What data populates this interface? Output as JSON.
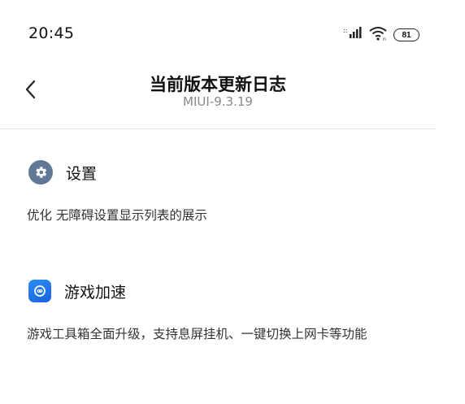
{
  "status_bar": {
    "time": "20:45",
    "signal_icon": "signal-bars-icon",
    "wifi_icon": "wifi-icon",
    "battery_level": "81"
  },
  "header": {
    "back_icon": "chevron-left-icon",
    "title": "当前版本更新日志",
    "subtitle": "MIUI-9.3.19"
  },
  "sections": [
    {
      "icon": "gear-icon",
      "title": "设置",
      "description": "优化 无障碍设置显示列表的展示"
    },
    {
      "icon": "game-controller-icon",
      "title": "游戏加速",
      "description": "游戏工具箱全面升级，支持息屏挂机、一键切换上网卡等功能"
    }
  ],
  "colors": {
    "settings_icon_bg": "#5f7895",
    "game_icon_bg": "#1a63e0",
    "divider": "#e6e6e6",
    "subtitle": "#888888"
  }
}
